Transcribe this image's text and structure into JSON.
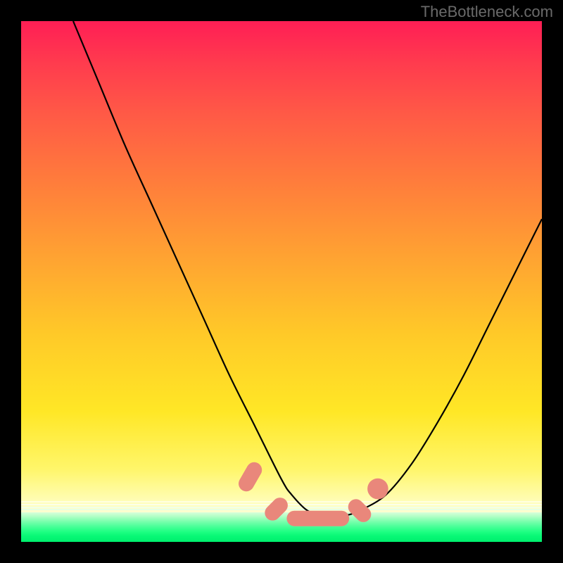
{
  "watermark": "TheBottleneck.com",
  "chart_data": {
    "type": "line",
    "title": "",
    "xlabel": "",
    "ylabel": "",
    "xlim": [
      0,
      100
    ],
    "ylim": [
      0,
      100
    ],
    "grid": false,
    "legend": false,
    "series": [
      {
        "name": "bottleneck-curve",
        "x": [
          10,
          15,
          20,
          25,
          30,
          35,
          40,
          45,
          50,
          52,
          55,
          58,
          60,
          62,
          65,
          70,
          75,
          80,
          85,
          90,
          95,
          100
        ],
        "values": [
          100,
          88,
          76,
          65,
          54,
          43,
          32,
          22,
          12,
          9,
          6,
          5,
          5,
          5,
          6,
          9,
          15,
          23,
          32,
          42,
          52,
          62
        ]
      }
    ],
    "markers": [
      {
        "name": "flat-marker-left",
        "x": 44,
        "y": 12.5,
        "shape": "rounded-bar",
        "angle": -60,
        "length": 6
      },
      {
        "name": "flat-marker-mid-l",
        "x": 49,
        "y": 6.3,
        "shape": "rounded-bar",
        "angle": -45,
        "length": 5
      },
      {
        "name": "flat-marker-center",
        "x": 57,
        "y": 4.5,
        "shape": "rounded-bar",
        "angle": 0,
        "length": 12
      },
      {
        "name": "flat-marker-mid-r",
        "x": 65,
        "y": 6.0,
        "shape": "rounded-bar",
        "angle": 45,
        "length": 5
      },
      {
        "name": "flat-marker-right",
        "x": 68.5,
        "y": 10.2,
        "shape": "dot",
        "angle": 0,
        "length": 2.5
      }
    ],
    "colors": {
      "curve": "#000000",
      "marker": "#e9877b",
      "gradient_top": "#ff1e55",
      "gradient_mid": "#ffe726",
      "gradient_bottom": "#00ef6d"
    }
  }
}
